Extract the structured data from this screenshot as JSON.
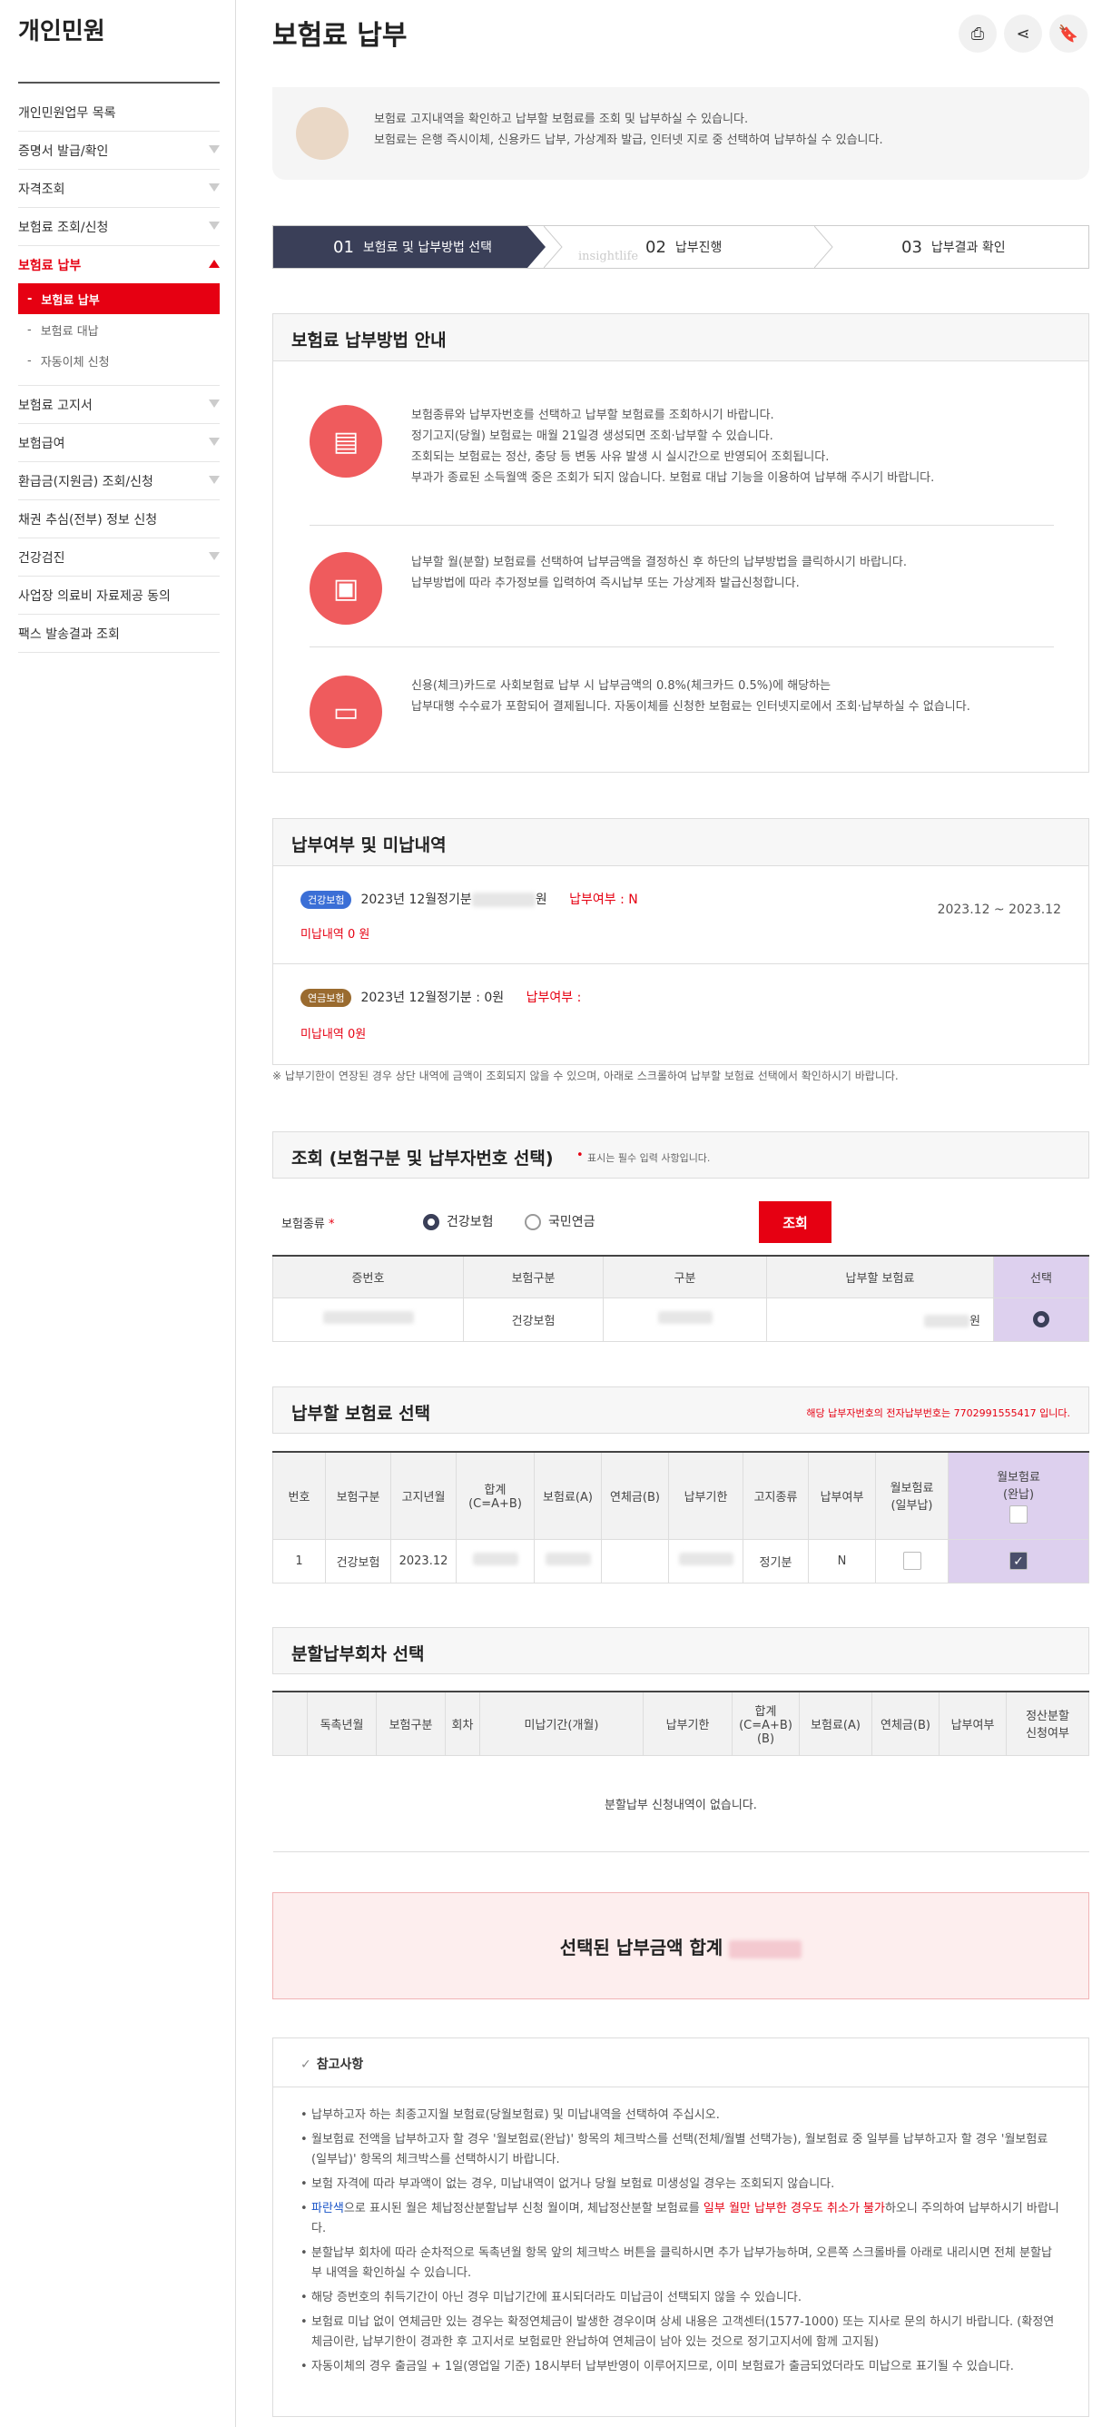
{
  "sidebar": {
    "title": "개인민원",
    "items": [
      {
        "label": "개인민원업무 목록",
        "chevron": false
      },
      {
        "label": "증명서 발급/확인",
        "chevron": true
      },
      {
        "label": "자격조회",
        "chevron": true
      },
      {
        "label": "보험료 조회/신청",
        "chevron": true
      },
      {
        "label": "보험료 납부",
        "chevron": true,
        "active": true
      },
      {
        "label": "보험료 고지서",
        "chevron": true
      },
      {
        "label": "보험급여",
        "chevron": true
      },
      {
        "label": "환급금(지원금) 조회/신청",
        "chevron": true
      },
      {
        "label": "채권 추심(전부) 정보 신청",
        "chevron": false
      },
      {
        "label": "건강검진",
        "chevron": true
      },
      {
        "label": "사업장 의료비 자료제공 동의",
        "chevron": false
      },
      {
        "label": "팩스 발송결과 조회",
        "chevron": false
      }
    ],
    "subitems": [
      {
        "label": "보험료 납부",
        "selected": true
      },
      {
        "label": "보험료 대납"
      },
      {
        "label": "자동이체 신청"
      }
    ]
  },
  "header": {
    "title": "보험료 납부",
    "print_icon": "print-icon",
    "share_icon": "share-icon",
    "bookmark_icon": "bookmark-icon"
  },
  "notice": {
    "line1": "보험료 고지내역을 확인하고 납부할 보험료를 조회 및 납부하실 수 있습니다.",
    "line2": "보험료는 은행 즉시이체, 신용카드 납부, 가상계좌 발급, 인터넷 지로 중 선택하여 납부하실 수 있습니다."
  },
  "steps": [
    {
      "num": "01",
      "label": "보험료 및 납부방법 선택"
    },
    {
      "num": "02",
      "label": "납부진행"
    },
    {
      "num": "03",
      "label": "납부결과 확인"
    }
  ],
  "watermark": "insightlife",
  "methods": {
    "title": "보험료 납부방법 안내",
    "items": [
      {
        "lines": [
          "보험종류와 납부자번호를 선택하고 납부할 보험료를 조회하시기 바랍니다.",
          "정기고지(당월) 보험료는 매월 21일경 생성되면 조회·납부할 수 있습니다.",
          "조회되는 보험료는 정산, 충당 등 변동 사유 발생 시 실시간으로 반영되어 조회됩니다.",
          "부과가 종료된 소득월액 중은 조회가 되지 않습니다. 보험료 대납 기능을 이용하여 납부해 주시기 바랍니다."
        ]
      },
      {
        "lines": [
          "납부할 월(분할) 보험료를 선택하여 납부금액을 결정하신 후 하단의 납부방법을 클릭하시기 바랍니다.",
          "납부방법에 따라 추가정보를 입력하여 즉시납부 또는 가상계좌 발급신청합니다."
        ]
      },
      {
        "lines": [
          "신용(체크)카드로 사회보험료 납부 시 납부금액의 0.8%(체크카드 0.5%)에 해당하는",
          "납부대행 수수료가 포함되어 결제됩니다. 자동이체를 신청한 보험료는 인터넷지로에서 조회·납부하실 수 없습니다."
        ]
      }
    ]
  },
  "status": {
    "title": "납부여부 및 미납내역",
    "health": {
      "badge": "건강보험",
      "text": "2023년 12월정기분",
      "suffix": "원",
      "paid_label": "납부여부 : N",
      "unpaid": "미납내역  0 원",
      "period": "2023.12 ~ 2023.12"
    },
    "pension": {
      "badge": "연금보험",
      "text": "2023년 12월정기분 : 0원",
      "paid_label": "납부여부 :",
      "unpaid": "미납내역  0원"
    },
    "note": "※ 납부기한이 연장된 경우 상단 내역에 금액이 조회되지 않을 수 있으며, 아래로 스크롤하여 납부할 보험료 선택에서 확인하시기 바랍니다."
  },
  "query": {
    "title": "조회 (보험구분 및 납부자번호 선택)",
    "required_note": "표시는 필수 입력 사항입니다.",
    "type_label": "보험종류",
    "opt_health": "건강보험",
    "opt_pension": "국민연금",
    "button": "조회",
    "headers": [
      "증번호",
      "보험구분",
      "구분",
      "납부할 보험료",
      "선택"
    ],
    "row": {
      "type": "건강보험",
      "amount_suffix": "원"
    }
  },
  "select": {
    "title": "납부할 보험료 선택",
    "info": "해당 납부자번호의 전자납부번호는 7702991555417 입니다.",
    "headers": [
      "번호",
      "보험구분",
      "고지년월",
      "합계\n(C=A+B)",
      "보험료(A)",
      "연체금(B)",
      "납부기한",
      "고지종류",
      "납부여부",
      "월보험료\n(일부납)",
      "월보험료\n(완납)"
    ],
    "row": {
      "no": "1",
      "type": "건강보험",
      "month": "2023.12",
      "kind": "정기분",
      "paid": "N"
    }
  },
  "install": {
    "title": "분할납부회차 선택",
    "headers": [
      "독촉년월",
      "보험구분",
      "회차",
      "미납기간(개월)",
      "납부기한",
      "합계(C=A+B)(B)",
      "보험료(A)",
      "연체금(B)",
      "납부여부",
      "정산분할\n신청여부"
    ],
    "empty": "분할납부 신청내역이 없습니다."
  },
  "total": {
    "label": "선택된 납부금액 합계"
  },
  "reference": {
    "title": "참고사항",
    "items": [
      "납부하고자 하는 최종고지월 보험료(당월보험료) 및 미납내역을 선택하여 주십시오.",
      "월보험료 전액을 납부하고자 할 경우 '월보험료(완납)' 항목의 체크박스를 선택(전체/월별 선택가능), 월보험료 중 일부를 납부하고자 할 경우 '월보험료(일부납)' 항목의 체크박스를 선택하시기 바랍니다.",
      "보험 자격에 따라 부과액이 없는 경우, 미납내역이 없거나 당월 보험료 미생성일 경우는 조회되지 않습니다.",
      "분할납부 회차에 따라 순차적으로 독촉년월 항목 앞의 체크박스 버튼을 클릭하시면 추가 납부가능하며, 오른쪽 스크롤바를 아래로 내리시면 전체 분할납부 내역을 확인하실 수 있습니다.",
      "해당 증번호의 취득기간이 아닌 경우 미납기간에 표시되더라도 미납금이 선택되지 않을 수 있습니다.",
      "보험료 미납 없이 연체금만 있는 경우는 확정연체금이 발생한 경우이며 상세 내용은 고객센터(1577-1000) 또는 지사로 문의 하시기 바랍니다. (확정연체금이란, 납부기한이 경과한 후 고지서로 보험료만 완납하여 연체금이 남아 있는 것으로 정기고지서에 함께 고지됨)",
      "자동이체의 경우 출금일 + 1일(영업일 기준) 18시부터 납부반영이 이루어지므로, 이미 보험료가 출금되었더라도 미납으로 표기될 수 있습니다."
    ],
    "blue_item": {
      "blue": "파란색",
      "mid": "으로 표시된 월은 체납정산분할납부 신청 월이며, 체납정산분할 보험료를 ",
      "red": "일부 월만 납부한 경우도 취소가 불가",
      "end": "하오니 주의하여 납부하시기 바랍니다."
    }
  }
}
